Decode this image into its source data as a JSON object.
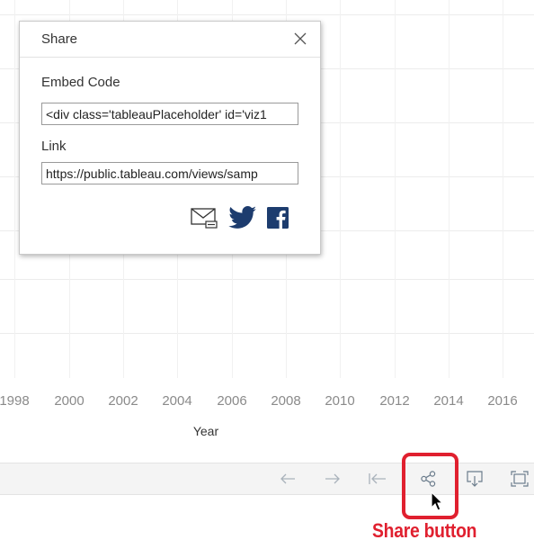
{
  "share_dialog": {
    "title": "Share",
    "embed_label": "Embed Code",
    "embed_value": "<div class='tableauPlaceholder' id='viz1",
    "link_label": "Link",
    "link_value": "https://public.tableau.com/views/samp",
    "share_icons": [
      "email-icon",
      "twitter-icon",
      "facebook-icon"
    ]
  },
  "x_axis": {
    "title": "Year",
    "ticks": [
      "1998",
      "2000",
      "2002",
      "2004",
      "2006",
      "2008",
      "2010",
      "2012",
      "2014",
      "2016"
    ]
  },
  "toolbar": {
    "buttons": [
      "back-arrow-icon",
      "forward-arrow-icon",
      "reset-icon",
      "share-icon",
      "download-icon",
      "fullscreen-icon"
    ]
  },
  "annotation": {
    "label": "Share button",
    "color": "#e0202f"
  },
  "colors": {
    "tableau_blue": "#1f4a7c",
    "twitter_blue": "#1d3c6e"
  }
}
